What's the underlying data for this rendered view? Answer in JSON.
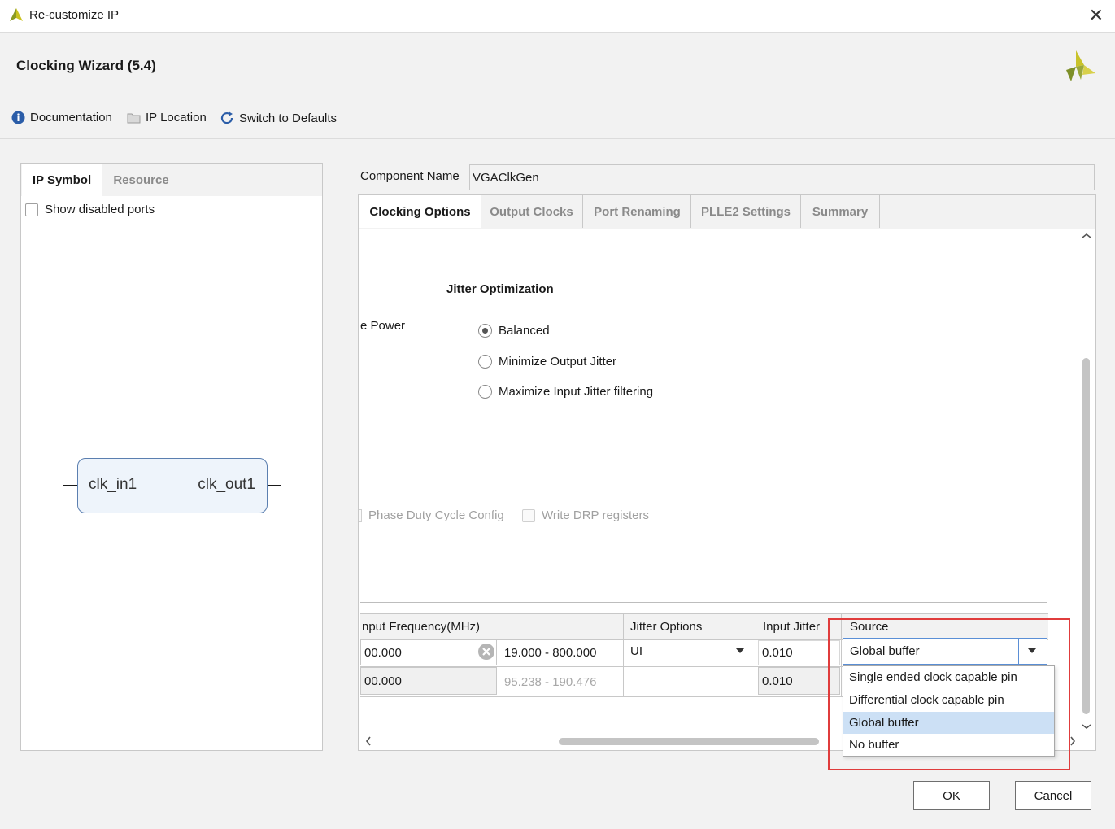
{
  "window": {
    "title": "Re-customize IP"
  },
  "header": {
    "title": "Clocking Wizard (5.4)"
  },
  "toolbar": {
    "documentation": "Documentation",
    "ip_location": "IP Location",
    "switch_defaults": "Switch to Defaults"
  },
  "left_panel": {
    "tabs": [
      "IP Symbol",
      "Resource"
    ],
    "show_disabled_ports": "Show disabled ports",
    "symbol": {
      "input_port": "clk_in1",
      "output_port": "clk_out1"
    }
  },
  "component": {
    "label": "Component Name",
    "value": "VGAClkGen"
  },
  "tabs": [
    "Clocking Options",
    "Output Clocks",
    "Port Renaming",
    "PLLE2 Settings",
    "Summary"
  ],
  "clocking_options": {
    "cut_label": "e Power",
    "jitter_section_title": "Jitter Optimization",
    "jitter_options": [
      "Balanced",
      "Minimize Output Jitter",
      "Maximize Input Jitter filtering"
    ],
    "selected_jitter_option": "Balanced",
    "phase_duty_cycle": "Phase Duty Cycle Config",
    "write_drp": "Write DRP registers"
  },
  "input_table": {
    "headers": [
      "nput Frequency(MHz)",
      "",
      "Jitter Options",
      "Input Jitter",
      "Source"
    ],
    "rows": [
      {
        "frequency": "00.000",
        "range": "19.000 - 800.000",
        "jitter_options": "UI",
        "input_jitter": "0.010",
        "source": "Global buffer"
      },
      {
        "frequency": "00.000",
        "range": "95.238 - 190.476",
        "jitter_options": "",
        "input_jitter": "0.010",
        "source": ""
      }
    ]
  },
  "source_dropdown": {
    "options": [
      "Single ended clock capable pin",
      "Differential clock capable pin",
      "Global buffer",
      "No buffer"
    ],
    "selected": "Global buffer"
  },
  "buttons": {
    "ok": "OK",
    "cancel": "Cancel"
  },
  "colors": {
    "highlight_box": "#e03c3c",
    "selected_option": "#cce0f5",
    "symbol_fill": "#eef4fb",
    "symbol_border": "#5b7fb0"
  }
}
